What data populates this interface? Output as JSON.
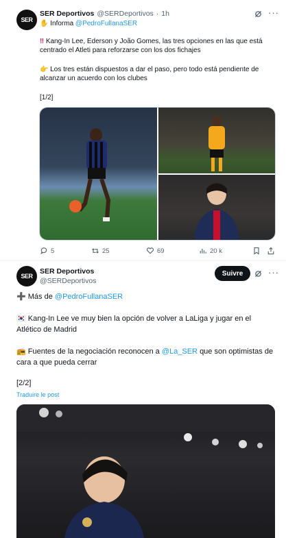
{
  "tweet1": {
    "author_name": "SER Deportivos",
    "author_handle": "@SERDeportivos",
    "dot": "·",
    "time": "1h",
    "line1_prefix": "Informa",
    "line1_mention": "@PedroFullanaSER",
    "para1": "Kang-In Lee, Ederson y João Gomes, las tres opciones en las que está centrado el Atleti para reforzarse con los dos fichajes",
    "para2": "Los tres están dispuestos a dar el paso, pero todo está pendiente de alcanzar un acuerdo con los clubes",
    "page": "[1/2]",
    "actions": {
      "replies": "5",
      "retweets": "25",
      "likes": "69",
      "views": "20 k"
    }
  },
  "tweet2": {
    "author_name": "SER Deportivos",
    "author_handle": "@SERDeportivos",
    "follow_label": "Suivre",
    "line1_prefix": "Más de",
    "line1_mention": "@PedroFullanaSER",
    "para1": "Kang-In Lee ve muy bien la opción de volver a LaLiga y jugar en el Atlético de Madrid",
    "para2_prefix": "Fuentes de la negociación reconocen a",
    "para2_mention": "@La_SER",
    "para2_suffix": "que son optimistas de cara a que pueda cerrar",
    "page": "[2/2]",
    "translate": "Traduire le post"
  },
  "colors": {
    "link": "#1d9bf0",
    "muted": "#536471",
    "text": "#0f1419"
  }
}
